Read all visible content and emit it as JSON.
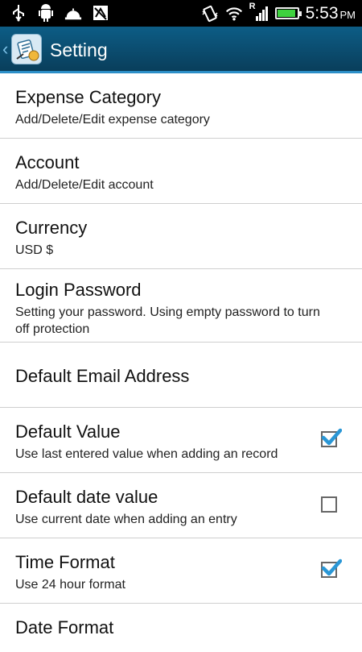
{
  "status": {
    "time": "5:53",
    "ampm": "PM",
    "network_badge": "R",
    "battery_level": 0.95,
    "icons": [
      "usb-icon",
      "android-debug-icon",
      "bell-icon",
      "calendar-icon",
      "vibrate-icon",
      "wifi-icon",
      "signal-icon",
      "battery-icon"
    ]
  },
  "appbar": {
    "title": "Setting",
    "color": "#0d5d86"
  },
  "settings": [
    {
      "title": "Expense Category",
      "subtitle": "Add/Delete/Edit expense category"
    },
    {
      "title": "Account",
      "subtitle": "Add/Delete/Edit account"
    },
    {
      "title": "Currency",
      "subtitle": "USD $"
    },
    {
      "title": "Login Password",
      "subtitle": "Setting your password. Using empty password to turn off protection"
    },
    {
      "title": "Default Email Address",
      "subtitle": ""
    },
    {
      "title": "Default Value",
      "subtitle": "Use last entered value when adding an record",
      "checked": true
    },
    {
      "title": "Default date value",
      "subtitle": "Use current date when adding an entry",
      "checked": false
    },
    {
      "title": "Time Format",
      "subtitle": "Use 24 hour format",
      "checked": true
    },
    {
      "title": "Date Format",
      "subtitle": ""
    }
  ],
  "accent_color": "#2a97d6"
}
